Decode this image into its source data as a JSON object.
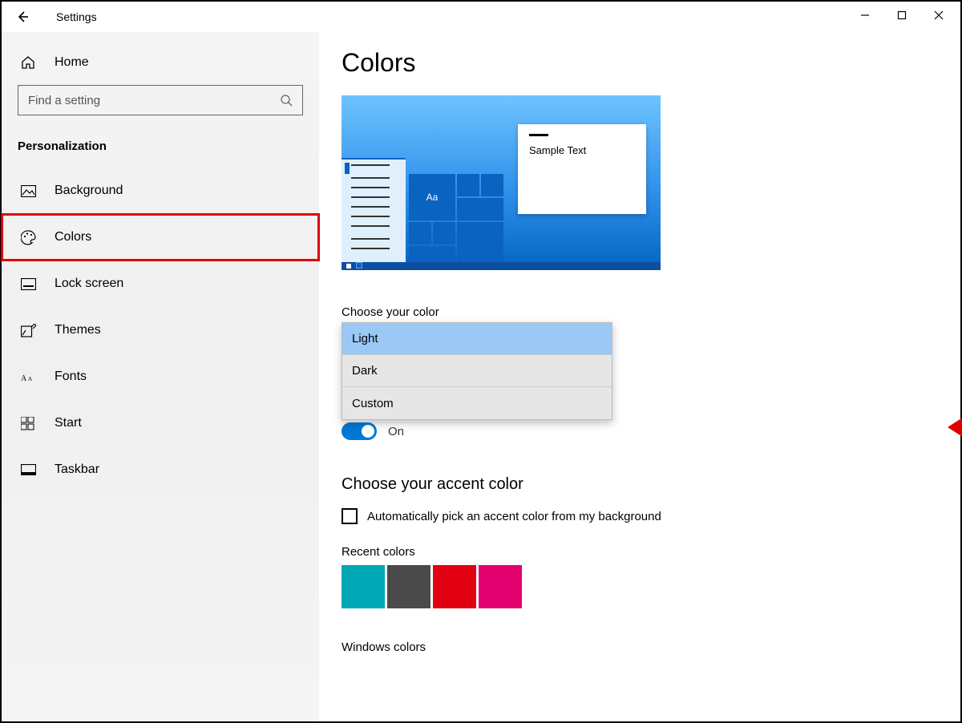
{
  "window": {
    "title": "Settings"
  },
  "sidebar": {
    "home": "Home",
    "search_placeholder": "Find a setting",
    "category": "Personalization",
    "items": [
      {
        "label": "Background"
      },
      {
        "label": "Colors"
      },
      {
        "label": "Lock screen"
      },
      {
        "label": "Themes"
      },
      {
        "label": "Fonts"
      },
      {
        "label": "Start"
      },
      {
        "label": "Taskbar"
      }
    ]
  },
  "page": {
    "title": "Colors",
    "preview_sample": "Sample Text",
    "preview_aa": "Aa",
    "choose_color_label": "Choose your color",
    "color_options": [
      "Light",
      "Dark",
      "Custom"
    ],
    "toggle_state": "On",
    "accent_heading": "Choose your accent color",
    "auto_pick_label": "Automatically pick an accent color from my background",
    "recent_label": "Recent colors",
    "recent_colors": [
      "#00a7b5",
      "#4a4a4a",
      "#e00012",
      "#e3006f"
    ],
    "windows_colors_label": "Windows colors"
  }
}
